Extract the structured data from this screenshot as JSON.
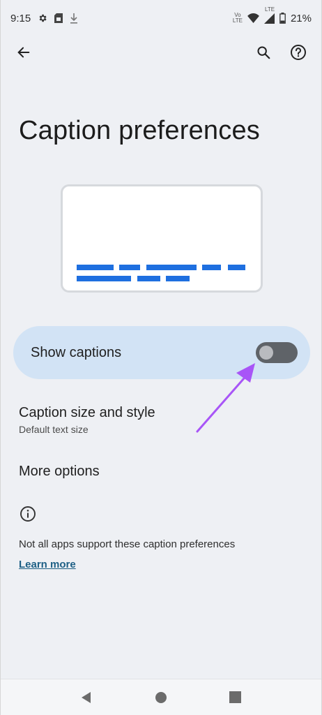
{
  "status_bar": {
    "time": "9:15",
    "battery_percent": "21%",
    "net_label_top": "Vo",
    "net_label_bottom": "LTE",
    "lte_label": "LTE",
    "icons": [
      "settings-gear-icon",
      "sim-card-icon",
      "download-icon",
      "wifi-icon",
      "signal-icon",
      "battery-icon"
    ]
  },
  "app_bar": {
    "back_icon": "arrow-back-icon",
    "search_icon": "search-icon",
    "help_icon": "help-circle-icon"
  },
  "page": {
    "title": "Caption preferences"
  },
  "show_captions": {
    "label": "Show captions",
    "enabled": false
  },
  "caption_size": {
    "title": "Caption size and style",
    "subtitle": "Default text size"
  },
  "more_options": {
    "title": "More options"
  },
  "info": {
    "text": "Not all apps support these caption preferences",
    "link": "Learn more"
  },
  "colors": {
    "accent": "#1e6fe0",
    "row_highlight": "#d2e3f5",
    "annotation_arrow": "#a855f7",
    "link": "#1d5f85"
  },
  "nav_bar": {
    "icons": [
      "back-triangle-icon",
      "home-circle-icon",
      "recents-square-icon"
    ]
  }
}
